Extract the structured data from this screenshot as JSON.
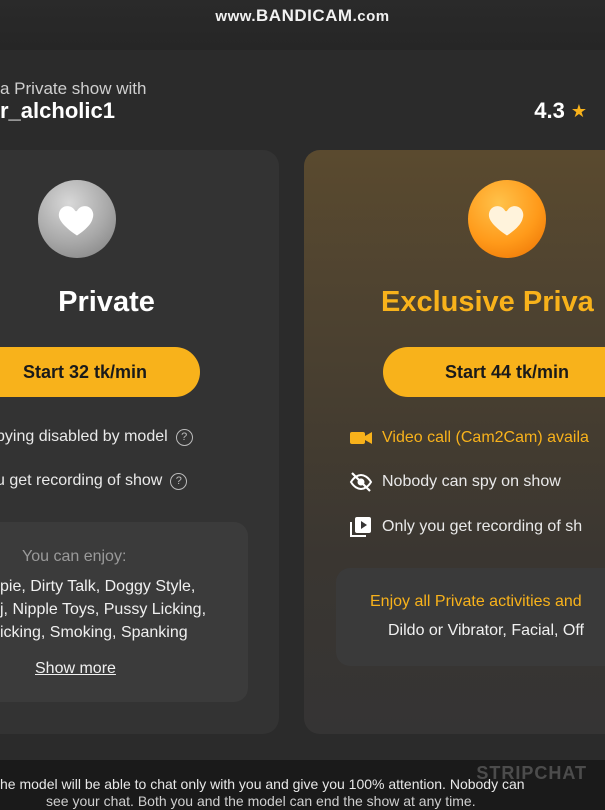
{
  "watermark": {
    "prefix": "www.",
    "brand": "BANDICAM",
    "suffix": ".com"
  },
  "header": {
    "subtitle": "a Private show with",
    "model_name": "r_alcholic1",
    "rating": "4.3"
  },
  "private_card": {
    "title": "Private",
    "button_label": "Start 32 tk/min",
    "features": [
      "pying disabled by model",
      "u get recording of show"
    ],
    "enjoy_title": "You can enjoy:",
    "enjoy_lines": [
      "pie, Dirty Talk, Doggy Style,",
      "j, Nipple Toys, Pussy Licking,",
      "icking, Smoking, Spanking"
    ],
    "show_more": "Show more"
  },
  "exclusive_card": {
    "title": "Exclusive Priva",
    "button_label": "Start 44 tk/min",
    "features": [
      {
        "icon": "video-camera-icon",
        "text": "Video call (Cam2Cam) availa"
      },
      {
        "icon": "eye-off-icon",
        "text": "Nobody can spy on show"
      },
      {
        "icon": "recording-icon",
        "text": "Only you get recording of sh"
      }
    ],
    "enjoy_title": "Enjoy all Private activities and",
    "enjoy_line": "Dildo or Vibrator, Facial, Off"
  },
  "footer": {
    "line1": "he model will be able to chat only with you and give you 100% attention. Nobody can",
    "line2": "see your chat. Both you and the model can end the show at any time.",
    "brand": "STRIPCHAT"
  },
  "colors": {
    "accent": "#f8b21b",
    "card_bg": "#333333",
    "modal_bg": "#2b2b2b"
  }
}
